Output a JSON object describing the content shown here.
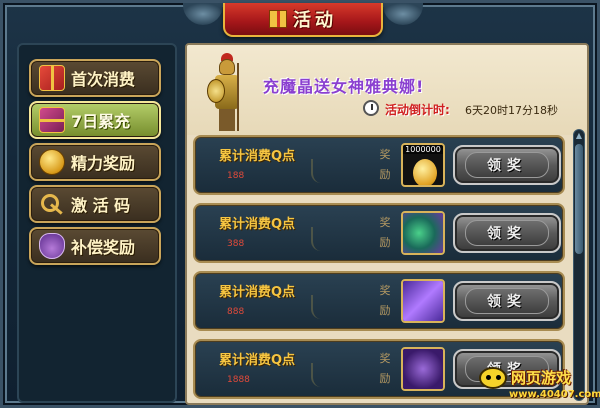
{
  "title": {
    "text": "活动",
    "icon": "gift-icon"
  },
  "sidebar": {
    "items": [
      {
        "label": "首次消费",
        "icon": "gift-icon",
        "active": false
      },
      {
        "label": "7日累充",
        "icon": "giftbox-icon",
        "active": true
      },
      {
        "label": "精力奖励",
        "icon": "coin-icon",
        "active": false
      },
      {
        "label": "激 活 码",
        "icon": "key-icon",
        "active": false
      },
      {
        "label": "补偿奖励",
        "icon": "gem-pouch-icon",
        "active": false
      }
    ]
  },
  "banner": {
    "promo": "充魔晶送女神雅典娜!",
    "countdown_label": "活动倒计时:",
    "countdown_value": "6天20时17分18秒"
  },
  "rows": [
    {
      "title": "累计消费Q点",
      "amount": "188",
      "reward_label": "奖励",
      "item": "coin",
      "item_qty": "1000000",
      "button": "领奖"
    },
    {
      "title": "累计消费Q点",
      "amount": "388",
      "reward_label": "奖励",
      "item": "green-dragon",
      "button": "领奖"
    },
    {
      "title": "累计消费Q点",
      "amount": "888",
      "reward_label": "奖励",
      "item": "purple-crystal",
      "button": "领奖"
    },
    {
      "title": "累计消费Q点",
      "amount": "1888",
      "reward_label": "奖励",
      "item": "purple-dragon",
      "button": "领奖"
    }
  ],
  "watermark": {
    "title": "网页游戏",
    "url": "www.40407.com"
  },
  "colors": {
    "title_red": "#a4161a",
    "gold": "#f5c542",
    "active_green": "#758c2c",
    "promo_purple": "#8a3fd0",
    "alert_red": "#d02020"
  }
}
